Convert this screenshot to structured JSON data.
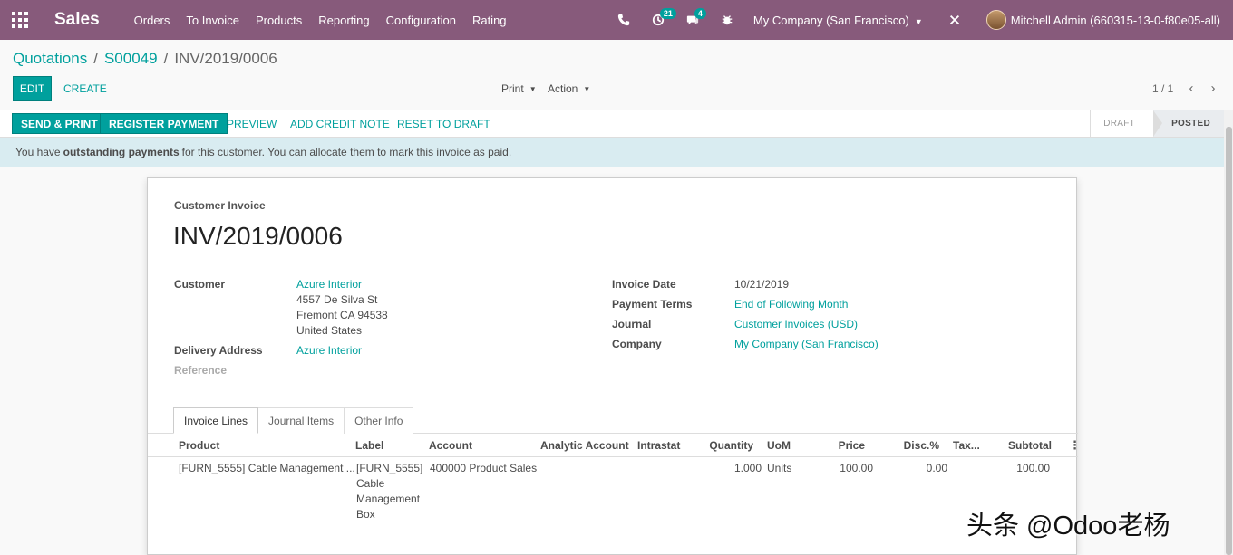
{
  "navbar": {
    "brand": "Sales",
    "menu": [
      "Orders",
      "To Invoice",
      "Products",
      "Reporting",
      "Configuration",
      "Rating"
    ],
    "activity_count": "21",
    "message_count": "4",
    "company": "My Company (San Francisco)",
    "user": "Mitchell Admin (660315-13-0-f80e05-all)",
    "icons": [
      "apps-grid-icon",
      "phone-icon",
      "clock-icon",
      "chat-icon",
      "bug-icon",
      "close-icon"
    ]
  },
  "breadcrumb": [
    "Quotations",
    "S00049",
    "INV/2019/0006"
  ],
  "control": {
    "edit": "EDIT",
    "create": "CREATE",
    "print": "Print",
    "action": "Action",
    "pager": "1 / 1"
  },
  "statusbar": {
    "buttons": [
      "SEND & PRINT",
      "REGISTER PAYMENT",
      "PREVIEW",
      "ADD CREDIT NOTE",
      "RESET TO DRAFT"
    ],
    "stages": [
      "DRAFT",
      "POSTED"
    ],
    "active_stage": "POSTED"
  },
  "alert": {
    "prefix": "You have",
    "bold": "outstanding payments",
    "suffix": "for this customer. You can allocate them to mark this invoice as paid."
  },
  "invoice": {
    "type": "Customer Invoice",
    "name": "INV/2019/0006",
    "labels": {
      "customer": "Customer",
      "delivery_address": "Delivery Address",
      "reference": "Reference",
      "invoice_date": "Invoice Date",
      "payment_terms": "Payment Terms",
      "journal": "Journal",
      "company": "Company"
    },
    "customer_name": "Azure Interior",
    "address": [
      "4557 De Silva St",
      "Fremont CA 94538",
      "United States"
    ],
    "delivery_address": "Azure Interior",
    "invoice_date": "10/21/2019",
    "payment_terms": "End of Following Month",
    "journal": "Customer Invoices (USD)",
    "company": "My Company (San Francisco)"
  },
  "tabs": [
    "Invoice Lines",
    "Journal Items",
    "Other Info"
  ],
  "table": {
    "columns": [
      "Product",
      "Label",
      "Account",
      "Analytic Account",
      "Intrastat",
      "Quantity",
      "UoM",
      "Price",
      "Disc.%",
      "Tax...",
      "Subtotal"
    ],
    "rows": [
      {
        "product": "[FURN_5555] Cable Management ...",
        "label": "[FURN_5555] Cable Management Box",
        "account": "400000 Product Sales",
        "analytic": "",
        "intrastat": "",
        "quantity": "1.000",
        "uom": "Units",
        "price": "100.00",
        "discount": "0.00",
        "taxes": "",
        "subtotal": "100.00"
      }
    ]
  },
  "watermark": "头条 @Odoo老杨"
}
